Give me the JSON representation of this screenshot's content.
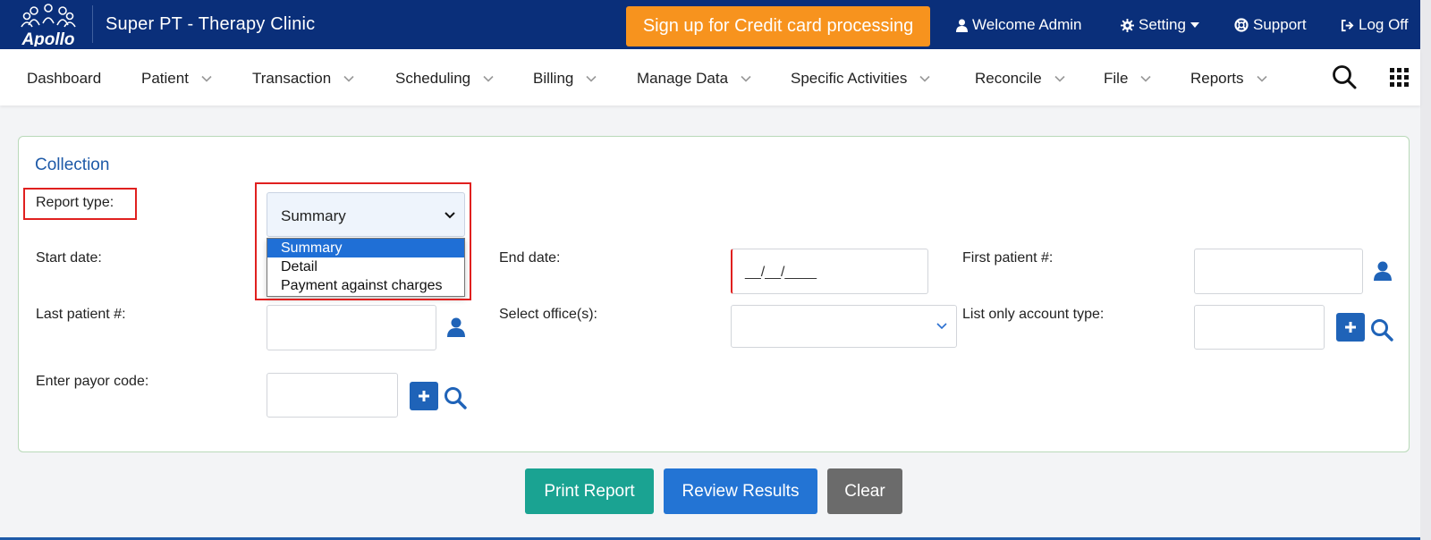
{
  "header": {
    "logo_text": "Apollo",
    "clinic_name": "Super PT - Therapy Clinic",
    "signup_label": "Sign up for Credit card processing",
    "welcome_label": "Welcome Admin",
    "setting_label": "Setting",
    "support_label": "Support",
    "logoff_label": "Log Off"
  },
  "nav": {
    "items": [
      {
        "label": "Dashboard"
      },
      {
        "label": "Patient"
      },
      {
        "label": "Transaction"
      },
      {
        "label": "Scheduling"
      },
      {
        "label": "Billing"
      },
      {
        "label": "Manage Data"
      },
      {
        "label": "Specific Activities"
      },
      {
        "label": "Reconcile"
      },
      {
        "label": "File"
      },
      {
        "label": "Reports"
      }
    ]
  },
  "form": {
    "title": "Collection",
    "report_type_label": "Report type:",
    "report_type_value": "Summary",
    "report_type_options": [
      "Summary",
      "Detail",
      "Payment against charges"
    ],
    "start_date_label": "Start date:",
    "end_date_label": "End date:",
    "end_date_value": "__/__/____",
    "first_patient_label": "First patient #:",
    "last_patient_label": "Last patient #:",
    "select_office_label": "Select office(s):",
    "account_type_label": "List only account type:",
    "payor_code_label": "Enter payor code:"
  },
  "actions": {
    "print_label": "Print Report",
    "review_label": "Review Results",
    "clear_label": "Clear"
  },
  "colors": {
    "header_bg": "#0a2f7a",
    "signup_bg": "#f7931e",
    "print_bg": "#1aa392",
    "review_bg": "#2374d4",
    "clear_bg": "#6b6b6b",
    "highlight": "#e0201f"
  }
}
